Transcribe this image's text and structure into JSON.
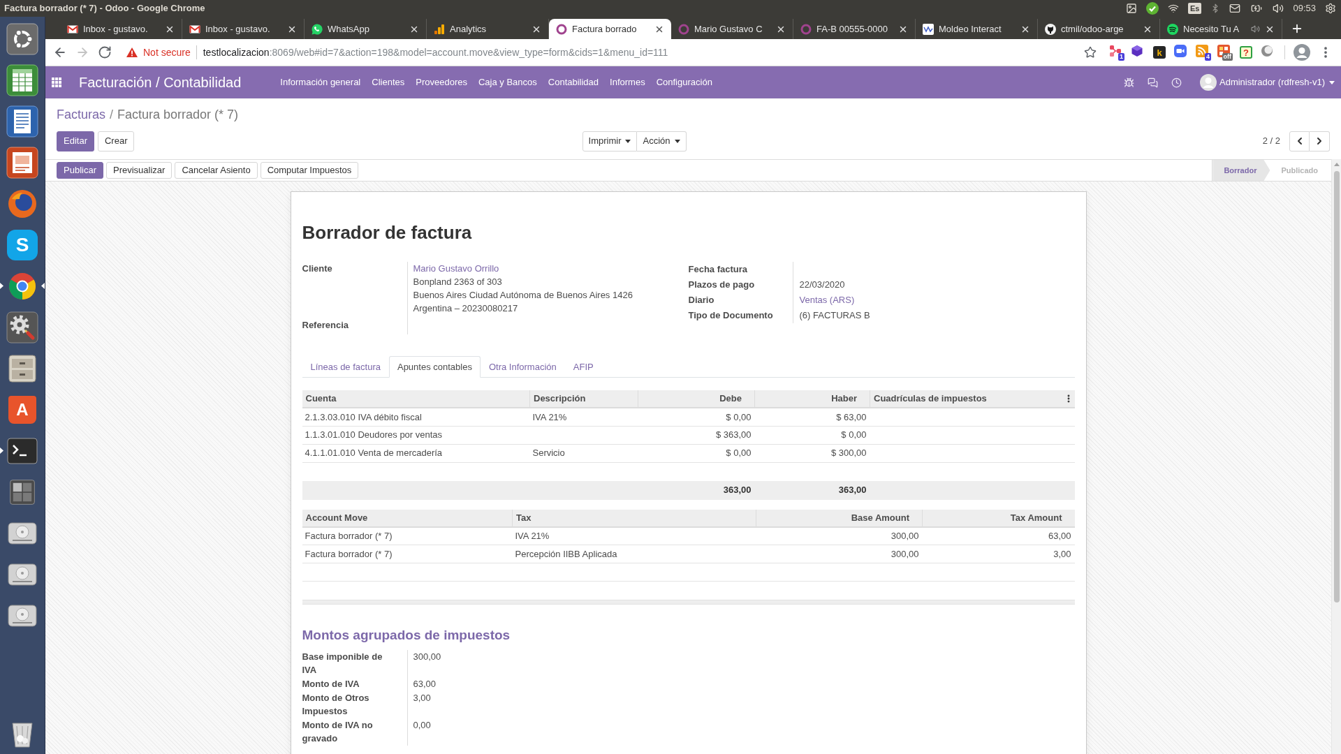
{
  "system_panel": {
    "title": "Factura borrador (* 7) - Odoo - Google Chrome",
    "keyboard": "Es",
    "time": "09:53"
  },
  "dock": [
    {
      "kind": "ring-logo",
      "running": false,
      "focused": false
    },
    {
      "kind": "spreadsheet",
      "running": false,
      "focused": false
    },
    {
      "kind": "document",
      "running": false,
      "focused": false
    },
    {
      "kind": "presentation",
      "running": false,
      "focused": false
    },
    {
      "kind": "globe",
      "running": false,
      "focused": false
    },
    {
      "kind": "letter-round",
      "glyph": "S",
      "running": false,
      "focused": false
    },
    {
      "kind": "browser",
      "running": true,
      "focused": true
    },
    {
      "kind": "tools",
      "running": false,
      "focused": false
    },
    {
      "kind": "cabinet",
      "running": false,
      "focused": false
    },
    {
      "kind": "bag",
      "glyph": "A",
      "running": false,
      "focused": false
    },
    {
      "kind": "terminal",
      "running": true,
      "focused": false
    },
    {
      "kind": "workspace",
      "running": false,
      "focused": false
    },
    {
      "kind": "disk",
      "running": false,
      "focused": false
    },
    {
      "kind": "disk",
      "running": false,
      "focused": false
    },
    {
      "kind": "disk",
      "running": false,
      "focused": false
    },
    {
      "kind": "trash",
      "running": false,
      "focused": false
    }
  ],
  "browser": {
    "tabs": [
      {
        "title": "Inbox - gustavo.",
        "kind": "mail",
        "selected": false,
        "audio": false
      },
      {
        "title": "Inbox - gustavo.",
        "kind": "mail",
        "selected": false,
        "audio": false
      },
      {
        "title": "WhatsApp",
        "kind": "chat",
        "selected": false,
        "audio": false
      },
      {
        "title": "Analytics",
        "kind": "chart",
        "selected": false,
        "audio": false
      },
      {
        "title": "Factura borrado",
        "kind": "ring",
        "selected": true,
        "audio": false
      },
      {
        "title": "Mario Gustavo C",
        "kind": "ring",
        "selected": false,
        "audio": false
      },
      {
        "title": "FA-B 00555-0000",
        "kind": "ring",
        "selected": false,
        "audio": false
      },
      {
        "title": "Moldeo Interact",
        "kind": "wave",
        "selected": false,
        "audio": false
      },
      {
        "title": "ctmil/odoo-arge",
        "kind": "cat",
        "selected": false,
        "audio": false
      },
      {
        "title": "Necesito Tu A",
        "kind": "arcs",
        "selected": false,
        "audio": true
      }
    ],
    "nav_buttons": [
      {
        "kind": "back",
        "disabled": false
      },
      {
        "kind": "forward",
        "disabled": true
      },
      {
        "kind": "reload",
        "disabled": false
      }
    ],
    "security": "Not secure",
    "url": {
      "host": "testlocalizacion",
      "path": ":8069/web#id=7&action=198&model=account.move&view_type=form&cids=1&menu_id=111"
    },
    "extensions": [
      {
        "kind": "nodes",
        "badge": "1"
      },
      {
        "kind": "cube"
      },
      {
        "kind": "letter-tile",
        "glyph": "k"
      },
      {
        "kind": "camera"
      },
      {
        "kind": "feed",
        "badge": "4"
      },
      {
        "kind": "blocks",
        "badge": "off"
      },
      {
        "kind": "help-tile",
        "glyph": "?"
      },
      {
        "kind": "moon"
      }
    ]
  },
  "navbar": {
    "app": "Facturación / Contabilidad",
    "menu": [
      "Información general",
      "Clientes",
      "Proveedores",
      "Caja y Bancos",
      "Contabilidad",
      "Informes",
      "Configuración"
    ],
    "user": "Administrador (rdfresh-v1)"
  },
  "control_panel": {
    "breadcrumb": [
      {
        "label": "Facturas",
        "link": true
      },
      {
        "label": "Factura borrador (* 7)",
        "link": false
      }
    ],
    "separator": "/",
    "buttons": [
      {
        "label": "Editar",
        "primary": true
      },
      {
        "label": "Crear",
        "primary": false
      }
    ],
    "dropdowns": [
      "Imprimir",
      "Acción"
    ],
    "pager": "2 / 2"
  },
  "statusbar": {
    "buttons": [
      {
        "label": "Publicar",
        "primary": true
      },
      {
        "label": "Previsualizar",
        "primary": false
      },
      {
        "label": "Cancelar Asiento",
        "primary": false
      },
      {
        "label": "Computar Impuestos",
        "primary": false
      }
    ],
    "stages": [
      {
        "label": "Borrador",
        "selected": true
      },
      {
        "label": "Publicado",
        "selected": false
      }
    ]
  },
  "form": {
    "title": "Borrador de factura",
    "customer": {
      "label": "Cliente",
      "name": "Mario Gustavo Orrillo",
      "address": [
        "Bonpland 2363 of 303",
        "Buenos Aires Ciudad Autónoma de Buenos Aires 1426",
        "Argentina – 20230080217"
      ]
    },
    "reference": {
      "label": "Referencia"
    },
    "details": [
      {
        "label": "Fecha factura"
      },
      {
        "label": "Plazos de pago",
        "value": "22/03/2020",
        "link": false
      },
      {
        "label": "Diario",
        "value": "Ventas (ARS)",
        "link": true
      },
      {
        "label": "Tipo de Documento",
        "value": "(6) FACTURAS B",
        "link": false
      }
    ],
    "tabs": [
      {
        "label": "Líneas de factura",
        "selected": false
      },
      {
        "label": "Apuntes contables",
        "selected": true
      },
      {
        "label": "Otra Información",
        "selected": false
      },
      {
        "label": "AFIP",
        "selected": false
      }
    ],
    "journal_items": {
      "columns": [
        {
          "label": "Cuenta",
          "numeric": false
        },
        {
          "label": "Descripción",
          "numeric": false
        },
        {
          "label": "Debe",
          "numeric": true
        },
        {
          "label": "Haber",
          "numeric": true
        },
        {
          "label": "Cuadrículas de impuestos",
          "numeric": false
        }
      ],
      "rows": [
        {
          "account": "2.1.3.03.010 IVA débito fiscal",
          "description": "IVA 21%",
          "debit": "$ 0,00",
          "credit": "$ 63,00"
        },
        {
          "account": "1.1.3.01.010 Deudores por ventas",
          "debit": "$ 363,00",
          "credit": "$ 0,00"
        },
        {
          "account": "4.1.1.01.010 Venta de mercadería",
          "description": "Servicio",
          "debit": "$ 0,00",
          "credit": "$ 300,00"
        }
      ],
      "totals": {
        "debit": "363,00",
        "credit": "363,00"
      }
    },
    "tax_lines": {
      "columns": [
        {
          "label": "Account Move",
          "numeric": false
        },
        {
          "label": "Tax",
          "numeric": false
        },
        {
          "label": "Base Amount",
          "numeric": true
        },
        {
          "label": "Tax Amount",
          "numeric": true
        }
      ],
      "rows": [
        {
          "move": "Factura borrador (* 7)",
          "tax": "IVA 21%",
          "base": "300,00",
          "amount": "63,00"
        },
        {
          "move": "Factura borrador (* 7)",
          "tax": "Percepción IIBB Aplicada",
          "base": "300,00",
          "amount": "3,00"
        }
      ]
    },
    "tax_summary": {
      "title": "Montos agrupados de impuestos",
      "fields": [
        {
          "label": "Base imponible de IVA",
          "value": "300,00"
        },
        {
          "label": "Monto de IVA",
          "value": "63,00"
        },
        {
          "label": "Monto de Otros Impuestos",
          "value": "3,00"
        },
        {
          "label": "Monto de IVA no gravado",
          "value": "0,00"
        }
      ]
    }
  }
}
